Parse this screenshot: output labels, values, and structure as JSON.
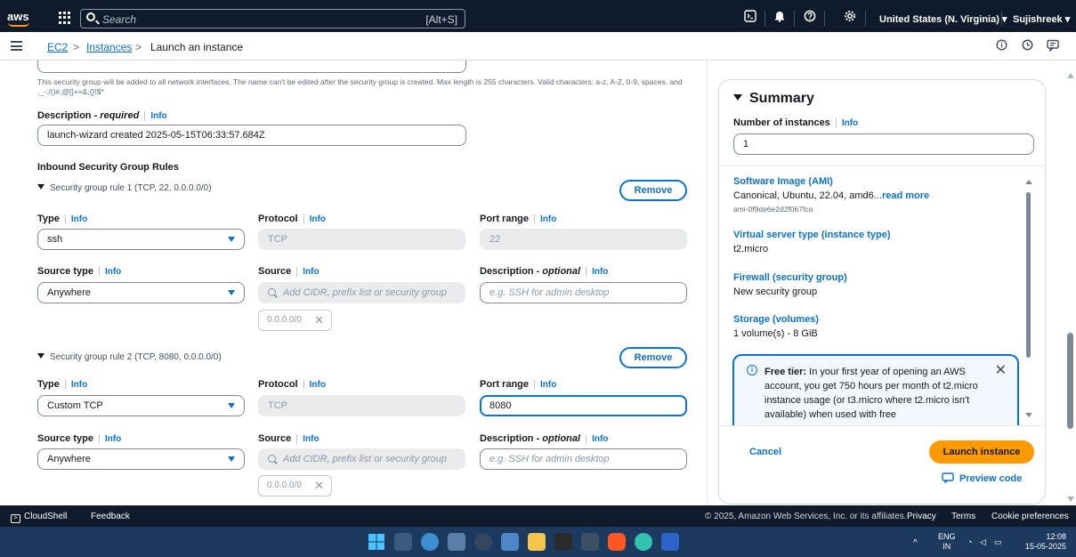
{
  "topnav": {
    "logo": "aws",
    "search_placeholder": "Search",
    "search_shortcut": "[Alt+S]",
    "region": "United States (N. Virginia) ▾",
    "user": "Sujishreek ▾"
  },
  "breadcrumb": {
    "items": [
      "EC2",
      "Instances",
      "Launch an instance"
    ],
    "separator": ">"
  },
  "form": {
    "name_help": "This security group will be added to all network interfaces. The name can't be edited after the security group is created. Max length is 255 characters. Valid characters: a-z, A-Z, 0-9, spaces, and ._-:/()#,@[]+=&;{}!$*",
    "description_label": "Description",
    "description_required": " - required",
    "description_value": "launch-wizard created 2025-05-15T06:33:57.684Z",
    "inbound_heading": "Inbound Security Group Rules",
    "info": "Info",
    "rules": [
      {
        "title": "Security group rule 1 (TCP, 22, 0.0.0.0/0)",
        "remove": "Remove",
        "type_label": "Type",
        "type_value": "ssh",
        "protocol_label": "Protocol",
        "protocol_value": "TCP",
        "port_label": "Port range",
        "port_value": "22",
        "source_type_label": "Source type",
        "source_type_value": "Anywhere",
        "source_label": "Source",
        "source_placeholder": "Add CIDR, prefix list or security group",
        "desc_label": "Description",
        "desc_optional": " - optional",
        "desc_placeholder": "e.g. SSH for admin desktop",
        "cidr_token": "0.0.0.0/0"
      },
      {
        "title": "Security group rule 2 (TCP, 8080, 0.0.0.0/0)",
        "remove": "Remove",
        "type_label": "Type",
        "type_value": "Custom TCP",
        "protocol_label": "Protocol",
        "protocol_value": "TCP",
        "port_label": "Port range",
        "port_value": "8080",
        "source_type_label": "Source type",
        "source_type_value": "Anywhere",
        "source_label": "Source",
        "source_placeholder": "Add CIDR, prefix list or security group",
        "desc_label": "Description",
        "desc_optional": " - optional",
        "desc_placeholder": "e.g. SSH for admin desktop",
        "cidr_token": "0.0.0.0/0"
      }
    ]
  },
  "summary": {
    "title": "Summary",
    "num_instances_label": "Number of instances",
    "num_instances_value": "1",
    "ami_label": "Software Image (AMI)",
    "ami_value": "Canonical, Ubuntu, 22.04, amd6...",
    "ami_read_more": "read more",
    "ami_id": "ami-0f9de6e2d2f067fca",
    "instance_type_label": "Virtual server type (instance type)",
    "instance_type_value": "t2.micro",
    "firewall_label": "Firewall (security group)",
    "firewall_value": "New security group",
    "storage_label": "Storage (volumes)",
    "storage_value": "1 volume(s) - 8 GiB",
    "free_tier_bold": "Free tier:",
    "free_tier_text": " In your first year of opening an AWS account, you get 750 hours per month of t2.micro instance usage (or t3.micro where t2.micro isn't available) when used with free",
    "cancel": "Cancel",
    "launch": "Launch instance",
    "preview": "Preview code"
  },
  "footer": {
    "cloudshell": "CloudShell",
    "feedback": "Feedback",
    "copyright": "© 2025, Amazon Web Services, Inc. or its affiliates.",
    "privacy": "Privacy",
    "terms": "Terms",
    "cookies": "Cookie preferences"
  },
  "taskbar": {
    "lang_top": "ENG",
    "lang_bottom": "IN",
    "time": "12:08",
    "date": "15-05-2025"
  },
  "colors": {
    "nav_bg": "#0f1b2a",
    "link": "#0972d3",
    "primary_button": "#ff9900",
    "taskbar": "#1b3a5e"
  }
}
